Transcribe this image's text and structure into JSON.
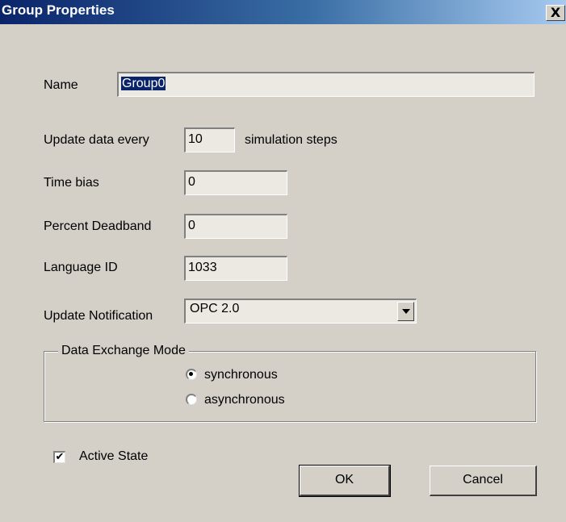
{
  "window": {
    "title": "Group Properties",
    "close_glyph": "X"
  },
  "form": {
    "name": {
      "label": "Name",
      "value": "Group0"
    },
    "update_rate": {
      "label": "Update data every",
      "value": "10",
      "suffix": "simulation steps"
    },
    "time_bias": {
      "label": "Time bias",
      "value": "0"
    },
    "percent_deadband": {
      "label": "Percent Deadband",
      "value": "0"
    },
    "language_id": {
      "label": "Language ID",
      "value": "1033"
    },
    "update_notification": {
      "label": "Update Notification",
      "selected": "OPC 2.0"
    }
  },
  "exchange_mode": {
    "legend": "Data Exchange Mode",
    "options": [
      {
        "label": "synchronous",
        "selected": true
      },
      {
        "label": "asynchronous",
        "selected": false
      }
    ]
  },
  "active_state": {
    "label": "Active State",
    "checked": true,
    "check_glyph": "✔"
  },
  "buttons": {
    "ok": "OK",
    "cancel": "Cancel"
  },
  "colors": {
    "title_bar_start": "#0a246a",
    "title_bar_end": "#a6caf0",
    "dialog_face": "#d4d0c8"
  },
  "icons": [
    "close-icon",
    "dropdown-arrow-icon",
    "radio-selected-icon",
    "checkmark-icon"
  ]
}
